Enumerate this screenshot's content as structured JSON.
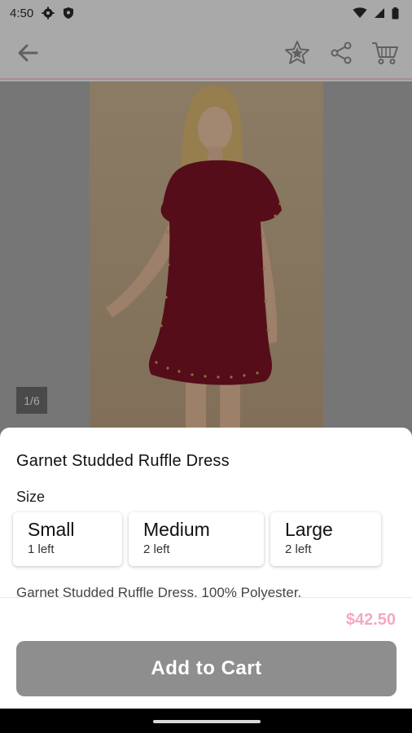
{
  "status": {
    "time": "4:50",
    "icons": [
      "settings-gear-icon",
      "shield-icon",
      "wifi-icon",
      "signal-icon",
      "battery-icon"
    ]
  },
  "appbar": {
    "icons": [
      "back-arrow-icon",
      "favorite-star-icon",
      "share-icon",
      "cart-icon"
    ]
  },
  "gallery": {
    "counter": "1/6"
  },
  "product": {
    "title": "Garnet Studded Ruffle Dress",
    "size_label": "Size",
    "sizes": [
      {
        "name": "Small",
        "stock": "1 left"
      },
      {
        "name": "Medium",
        "stock": "2 left"
      },
      {
        "name": "Large",
        "stock": "2 left"
      }
    ],
    "description": "Garnet Studded Ruffle Dress. 100% Polyester.",
    "price": "$42.50",
    "add_to_cart_label": "Add to Cart"
  },
  "colors": {
    "price": "#f4a8c4",
    "button": "#8e8e8e",
    "dress": "#7a1424",
    "pink_divider": "#f4c6d2"
  }
}
